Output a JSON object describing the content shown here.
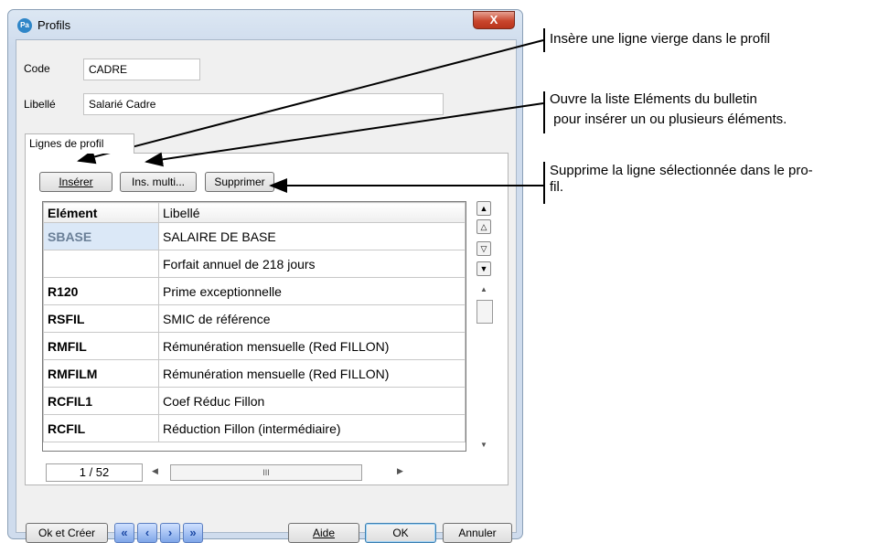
{
  "window": {
    "title": "Profils",
    "app_icon": "Pa",
    "close_label": "X"
  },
  "form": {
    "code_label": "Code",
    "code_value": "CADRE",
    "libelle_label": "Libellé",
    "libelle_value": "Salarié Cadre"
  },
  "tabs": [
    {
      "label": "Lignes de profil",
      "selected": true
    }
  ],
  "toolbar": {
    "insert_label": "Insérer",
    "insert_multi_label": "Ins. multi...",
    "delete_label": "Supprimer"
  },
  "grid": {
    "columns": [
      "Elément",
      "Libellé"
    ],
    "rows": [
      {
        "element": "SBASE",
        "libelle": "SALAIRE DE BASE"
      },
      {
        "element": "",
        "libelle": "Forfait annuel de 218 jours"
      },
      {
        "element": "R120",
        "libelle": "Prime exceptionnelle"
      },
      {
        "element": "RSFIL",
        "libelle": "SMIC de référence"
      },
      {
        "element": "RMFIL",
        "libelle": "Rémunération mensuelle (Red FILLON)"
      },
      {
        "element": "RMFILM",
        "libelle": "Rémunération mensuelle (Red FILLON)"
      },
      {
        "element": "RCFIL1",
        "libelle": "Coef Réduc Fillon"
      },
      {
        "element": "RCFIL",
        "libelle": "Réduction Fillon (intermédiaire)"
      }
    ],
    "counter": "1 / 52",
    "hscroll_grip": "III"
  },
  "footer": {
    "ok_create_label": "Ok et Créer",
    "help_label": "Aide",
    "ok_label": "OK",
    "cancel_label": "Annuler"
  },
  "annotations": {
    "insert_note": "Insère une ligne vierge dans le profil",
    "multi_note_line1": "Ouvre la liste Eléments du bulletin",
    "multi_note_line2": " pour insérer un ou plusieurs éléments.",
    "delete_note_line1": "Supprime la ligne sélectionnée dans le pro-",
    "delete_note_line2": "fil."
  },
  "colors": {
    "title_bar": "#cfdced",
    "close_button": "#c9462d",
    "selected_cell": "#dbe8f7",
    "nav_buttons": "#7fa6e8"
  }
}
